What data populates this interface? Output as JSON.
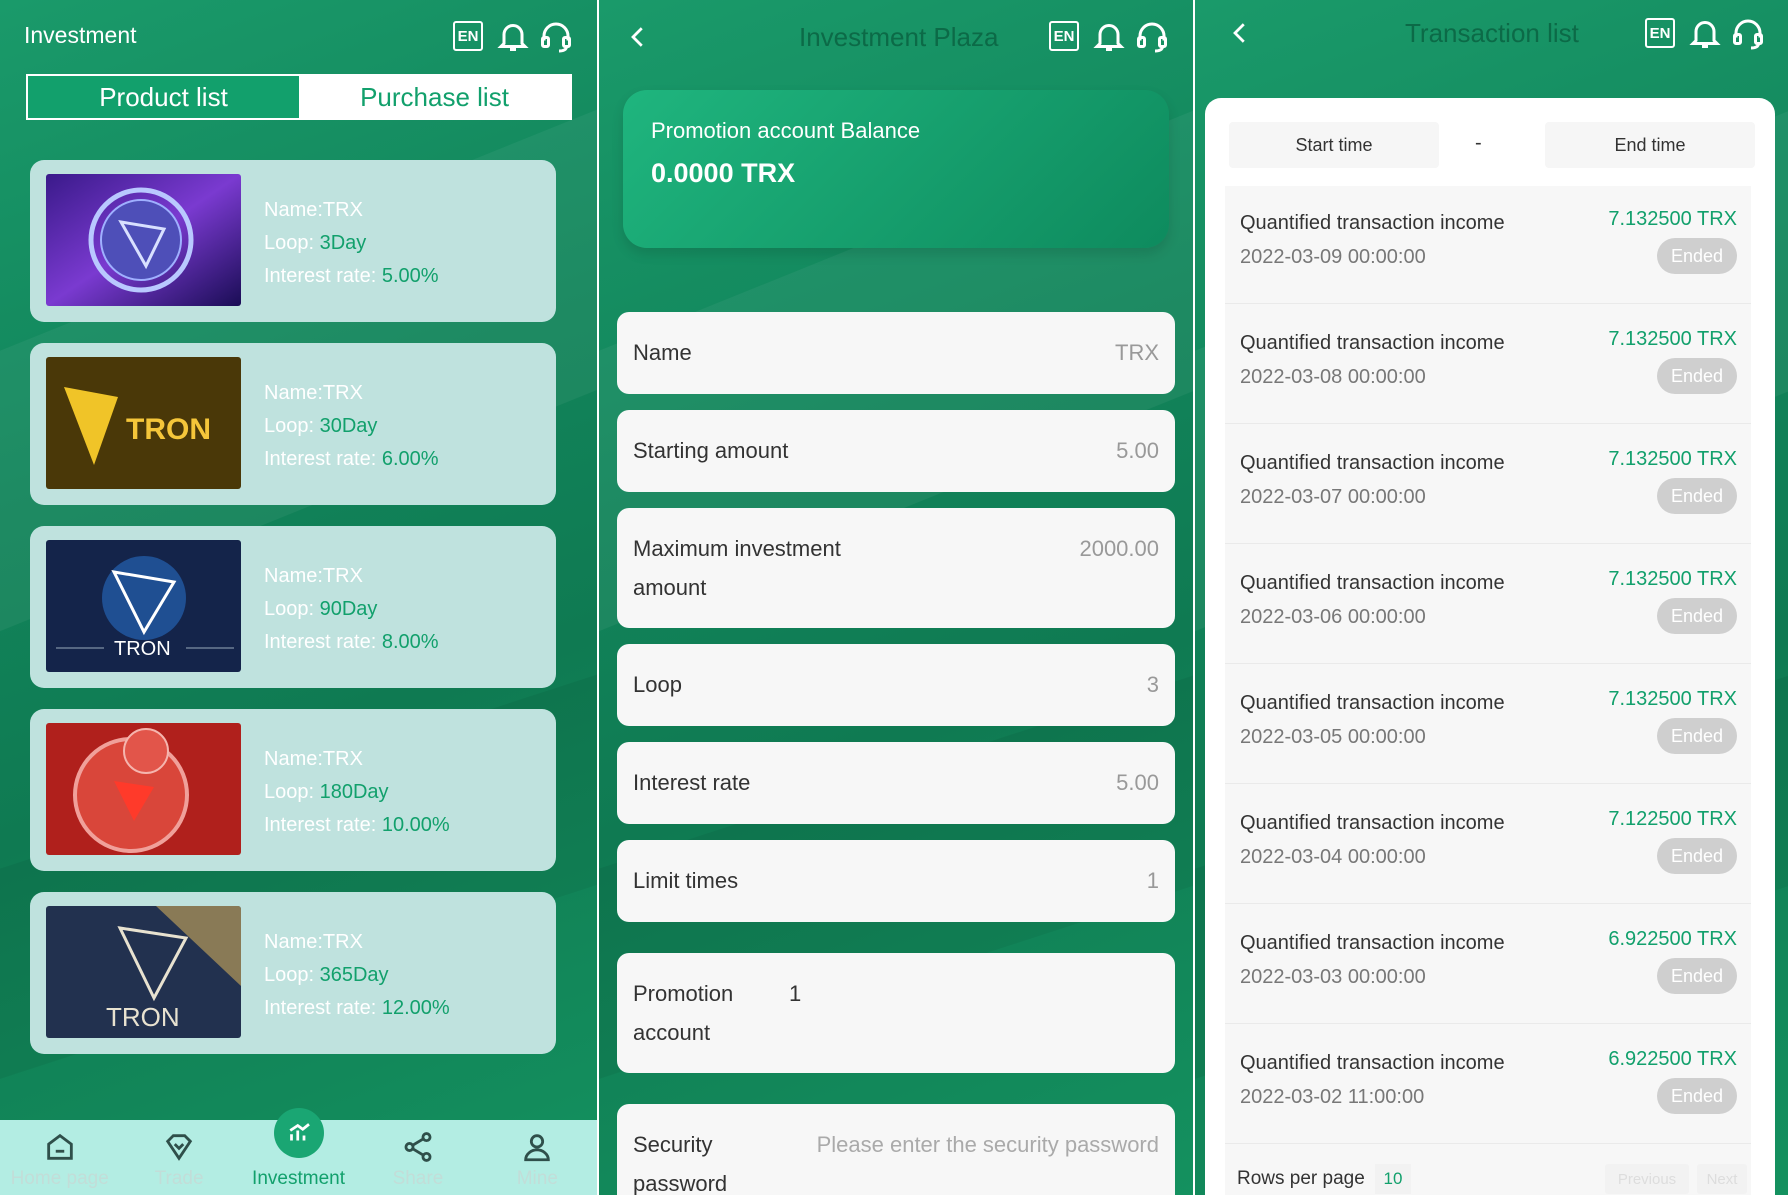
{
  "panel1": {
    "title": "Investment",
    "segment": {
      "product_list": "Product list",
      "purchase_list": "Purchase list"
    },
    "lang": "EN",
    "products": [
      {
        "name_label": "Name:",
        "name": "TRX",
        "loop_label": "Loop: ",
        "loop": "3Day",
        "rate_label": "Interest rate: ",
        "rate": "5.00%"
      },
      {
        "name_label": "Name:",
        "name": "TRX",
        "loop_label": "Loop: ",
        "loop": "30Day",
        "rate_label": "Interest rate: ",
        "rate": "6.00%"
      },
      {
        "name_label": "Name:",
        "name": "TRX",
        "loop_label": "Loop: ",
        "loop": "90Day",
        "rate_label": "Interest rate: ",
        "rate": "8.00%"
      },
      {
        "name_label": "Name:",
        "name": "TRX",
        "loop_label": "Loop: ",
        "loop": "180Day",
        "rate_label": "Interest rate: ",
        "rate": "10.00%"
      },
      {
        "name_label": "Name:",
        "name": "TRX",
        "loop_label": "Loop: ",
        "loop": "365Day",
        "rate_label": "Interest rate: ",
        "rate": "12.00%"
      }
    ],
    "thumb_text": {
      "t2": "TRON",
      "t3": "TRON",
      "t5": "TRON"
    },
    "tabs": [
      "Home page",
      "Trade",
      "Investment",
      "Share",
      "Mine"
    ]
  },
  "panel2": {
    "title": "Investment Plaza",
    "lang": "EN",
    "balance_label": "Promotion account Balance",
    "balance_value": "0.0000 TRX",
    "fields": {
      "name_label": "Name",
      "name_value": "TRX",
      "start_label": "Starting amount",
      "start_value": "5.00",
      "max_label_1": "Maximum investment",
      "max_label_2": "amount",
      "max_value": "2000.00",
      "loop_label": "Loop",
      "loop_value": "3",
      "rate_label": "Interest rate",
      "rate_value": "5.00",
      "limit_label": "Limit times",
      "limit_value": "1",
      "promo_label_1": "Promotion",
      "promo_label_2": "account",
      "promo_value": "1",
      "security_label_1": "Security",
      "security_label_2": "password",
      "security_placeholder": "Please enter the security password"
    }
  },
  "panel3": {
    "title": "Transaction list",
    "lang": "EN",
    "start_time": "Start time",
    "separator": "-",
    "end_time": "End time",
    "transactions": [
      {
        "title": "Quantified transaction income",
        "date": "2022-03-09 00:00:00",
        "amount": "7.132500 TRX",
        "status": "Ended"
      },
      {
        "title": "Quantified transaction income",
        "date": "2022-03-08 00:00:00",
        "amount": "7.132500 TRX",
        "status": "Ended"
      },
      {
        "title": "Quantified transaction income",
        "date": "2022-03-07 00:00:00",
        "amount": "7.132500 TRX",
        "status": "Ended"
      },
      {
        "title": "Quantified transaction income",
        "date": "2022-03-06 00:00:00",
        "amount": "7.132500 TRX",
        "status": "Ended"
      },
      {
        "title": "Quantified transaction income",
        "date": "2022-03-05 00:00:00",
        "amount": "7.132500 TRX",
        "status": "Ended"
      },
      {
        "title": "Quantified transaction income",
        "date": "2022-03-04 00:00:00",
        "amount": "7.122500 TRX",
        "status": "Ended"
      },
      {
        "title": "Quantified transaction income",
        "date": "2022-03-03 00:00:00",
        "amount": "6.922500 TRX",
        "status": "Ended"
      },
      {
        "title": "Quantified transaction income",
        "date": "2022-03-02 11:00:00",
        "amount": "6.922500 TRX",
        "status": "Ended"
      }
    ],
    "rows_per_page_label": "Rows per page",
    "rows_per_page": "10",
    "previous": "Previous",
    "next": "Next"
  }
}
